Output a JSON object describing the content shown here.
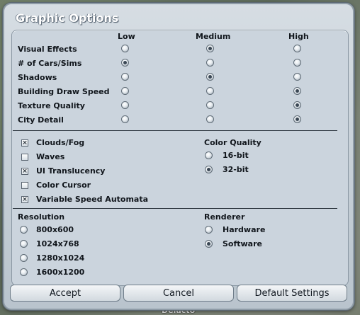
{
  "dialog": {
    "title": "Graphic Options",
    "levels": [
      "Low",
      "Medium",
      "High"
    ],
    "quality_rows": [
      {
        "label": "Visual Effects",
        "selected": "Medium"
      },
      {
        "label": "# of Cars/Sims",
        "selected": "Low"
      },
      {
        "label": "Shadows",
        "selected": "Medium"
      },
      {
        "label": "Building Draw Speed",
        "selected": "High"
      },
      {
        "label": "Texture Quality",
        "selected": "High"
      },
      {
        "label": "City Detail",
        "selected": "High"
      }
    ],
    "checkboxes": [
      {
        "label": "Clouds/Fog",
        "checked": true
      },
      {
        "label": "Waves",
        "checked": false
      },
      {
        "label": "UI Translucency",
        "checked": true
      },
      {
        "label": "Color Cursor",
        "checked": false
      },
      {
        "label": "Variable Speed Automata",
        "checked": true
      }
    ],
    "color_quality": {
      "label": "Color Quality",
      "options": [
        {
          "label": "16-bit",
          "selected": false
        },
        {
          "label": "32-bit",
          "selected": true
        }
      ]
    },
    "resolution": {
      "label": "Resolution",
      "options": [
        {
          "label": "800x600",
          "selected": false
        },
        {
          "label": "1024x768",
          "selected": false
        },
        {
          "label": "1280x1024",
          "selected": false
        },
        {
          "label": "1600x1200",
          "selected": false
        }
      ]
    },
    "renderer": {
      "label": "Renderer",
      "options": [
        {
          "label": "Hardware",
          "selected": false
        },
        {
          "label": "Software",
          "selected": true
        }
      ]
    },
    "buttons": {
      "accept": "Accept",
      "cancel": "Cancel",
      "default": "Default Settings"
    }
  },
  "background": {
    "map_label": "Delacto"
  }
}
